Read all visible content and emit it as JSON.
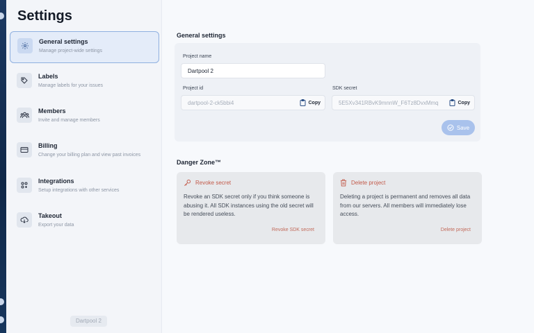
{
  "sidebar": {
    "title": "Settings",
    "items": [
      {
        "icon": "gear-icon",
        "label": "General settings",
        "sub": "Manage project-wide settings",
        "active": true
      },
      {
        "icon": "label-icon",
        "label": "Labels",
        "sub": "Manage labels for your issues"
      },
      {
        "icon": "members-icon",
        "label": "Members",
        "sub": "Invite and manage members"
      },
      {
        "icon": "credit-card-icon",
        "label": "Billing",
        "sub": "Change your billing plan and view past invoices"
      },
      {
        "icon": "integrations-icon",
        "label": "Integrations",
        "sub": "Setup integrations with other services"
      },
      {
        "icon": "takeout-icon",
        "label": "Takeout",
        "sub": "Export your data"
      }
    ],
    "workspace": "Dartpool 2"
  },
  "general": {
    "title": "General settings",
    "project_name_label": "Project name",
    "project_name_value": "Dartpool 2",
    "project_id_label": "Project id",
    "project_id_value": "dartpool-2-ck5bbi4",
    "sdk_secret_label": "SDK secret",
    "sdk_secret_value": "5E5Xv341RBvK9mnnW_F6Tz8DvxMmq",
    "copy_label": "Copy",
    "save_label": "Save"
  },
  "danger": {
    "title": "Danger Zone™",
    "revoke": {
      "title": "Revoke secret",
      "text": "Revoke an SDK secret only if you think someone is abusing it. All SDK instances using the old secret will be rendered useless.",
      "action": "Revoke SDK secret"
    },
    "delete": {
      "title": "Delete project",
      "text": "Deleting a project is permanent and removes all data from our servers. All members will immediately lose access.",
      "action": "Delete project"
    }
  },
  "colors": {
    "accent": "#8fb0e0",
    "danger": "#c25a4a",
    "rail": "#0f2748"
  }
}
